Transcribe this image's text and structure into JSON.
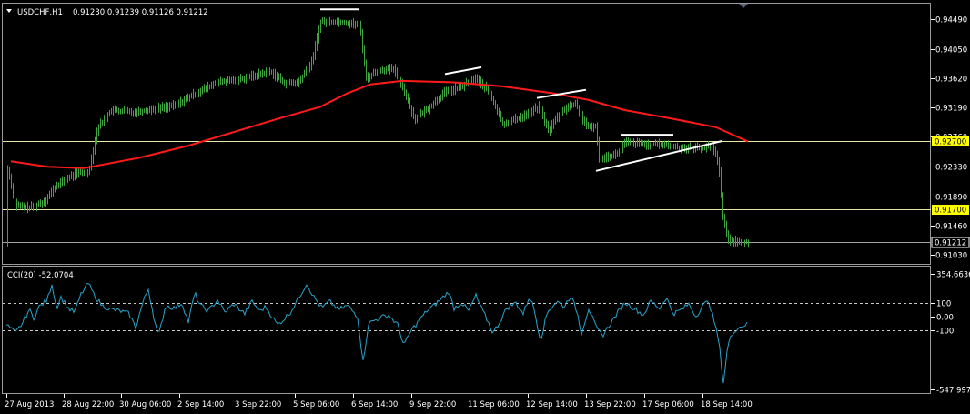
{
  "window": {
    "symbol": "USDCHF,H1",
    "ohlc": "0.91230 0.91239 0.91126 0.91212",
    "indicator_label": "CCI(20) -52.0704"
  },
  "colors": {
    "background": "#000000",
    "candles": "#3fa53f",
    "moving_average": "#ff1a1a",
    "trendlines": "#ffffff",
    "cci_line": "#29a3c8",
    "levels": "#e6e6a8",
    "price_tag": "#ffff00",
    "frame": "#9a9a9a"
  },
  "chart_data": [
    {
      "type": "candlestick",
      "symbol": "USDCHF",
      "timeframe": "H1",
      "ylim": [
        0.9091,
        0.947
      ],
      "y_ticks": [
        "0.94490",
        "0.94050",
        "0.93620",
        "0.93190",
        "0.92760",
        "0.92330",
        "0.91890",
        "0.91460",
        "0.91030"
      ],
      "horizontal_levels": [
        {
          "value": 0.927,
          "label": "0.92700"
        },
        {
          "value": 0.917,
          "label": "0.91700"
        },
        {
          "value": 0.91212,
          "label": "0.91212"
        }
      ],
      "x_ticks": [
        "27 Aug 2013",
        "28 Aug 22:00",
        "30 Aug 06:00",
        "2 Sep 14:00",
        "3 Sep 22:00",
        "5 Sep 06:00",
        "6 Sep 14:00",
        "9 Sep 22:00",
        "11 Sep 06:00",
        "12 Sep 14:00",
        "13 Sep 22:00",
        "17 Sep 06:00",
        "18 Sep 14:00"
      ],
      "close_path": [
        {
          "t": 0,
          "v": 0.9235
        },
        {
          "t": 10,
          "v": 0.9175
        },
        {
          "t": 25,
          "v": 0.9172
        },
        {
          "t": 40,
          "v": 0.918
        },
        {
          "t": 55,
          "v": 0.9205
        },
        {
          "t": 75,
          "v": 0.9222
        },
        {
          "t": 90,
          "v": 0.9225
        },
        {
          "t": 100,
          "v": 0.929
        },
        {
          "t": 115,
          "v": 0.9315
        },
        {
          "t": 140,
          "v": 0.9312
        },
        {
          "t": 165,
          "v": 0.9318
        },
        {
          "t": 185,
          "v": 0.9322
        },
        {
          "t": 205,
          "v": 0.9338
        },
        {
          "t": 230,
          "v": 0.9355
        },
        {
          "t": 260,
          "v": 0.9362
        },
        {
          "t": 290,
          "v": 0.9372
        },
        {
          "t": 305,
          "v": 0.9355
        },
        {
          "t": 320,
          "v": 0.9355
        },
        {
          "t": 335,
          "v": 0.9385
        },
        {
          "t": 345,
          "v": 0.9445
        },
        {
          "t": 365,
          "v": 0.9445
        },
        {
          "t": 388,
          "v": 0.944
        },
        {
          "t": 395,
          "v": 0.9362
        },
        {
          "t": 410,
          "v": 0.9375
        },
        {
          "t": 425,
          "v": 0.9375
        },
        {
          "t": 435,
          "v": 0.935
        },
        {
          "t": 448,
          "v": 0.9302
        },
        {
          "t": 465,
          "v": 0.932
        },
        {
          "t": 480,
          "v": 0.934
        },
        {
          "t": 500,
          "v": 0.935
        },
        {
          "t": 515,
          "v": 0.9362
        },
        {
          "t": 530,
          "v": 0.9342
        },
        {
          "t": 545,
          "v": 0.9295
        },
        {
          "t": 565,
          "v": 0.9305
        },
        {
          "t": 585,
          "v": 0.932
        },
        {
          "t": 595,
          "v": 0.9285
        },
        {
          "t": 610,
          "v": 0.9315
        },
        {
          "t": 625,
          "v": 0.9325
        },
        {
          "t": 637,
          "v": 0.929
        },
        {
          "t": 648,
          "v": 0.9292
        },
        {
          "t": 650,
          "v": 0.9245
        },
        {
          "t": 670,
          "v": 0.925
        },
        {
          "t": 680,
          "v": 0.9268
        },
        {
          "t": 700,
          "v": 0.9265
        },
        {
          "t": 720,
          "v": 0.9265
        },
        {
          "t": 740,
          "v": 0.926
        },
        {
          "t": 760,
          "v": 0.926
        },
        {
          "t": 775,
          "v": 0.9262
        },
        {
          "t": 782,
          "v": 0.924
        },
        {
          "t": 787,
          "v": 0.916
        },
        {
          "t": 792,
          "v": 0.9125
        },
        {
          "t": 805,
          "v": 0.9122
        },
        {
          "t": 815,
          "v": 0.9121
        }
      ],
      "moving_average": [
        {
          "t": 5,
          "v": 0.924
        },
        {
          "t": 45,
          "v": 0.9232
        },
        {
          "t": 85,
          "v": 0.923
        },
        {
          "t": 145,
          "v": 0.9245
        },
        {
          "t": 200,
          "v": 0.9263
        },
        {
          "t": 255,
          "v": 0.9285
        },
        {
          "t": 300,
          "v": 0.9303
        },
        {
          "t": 345,
          "v": 0.932
        },
        {
          "t": 375,
          "v": 0.934
        },
        {
          "t": 400,
          "v": 0.9353
        },
        {
          "t": 435,
          "v": 0.9358
        },
        {
          "t": 490,
          "v": 0.9356
        },
        {
          "t": 545,
          "v": 0.935
        },
        {
          "t": 600,
          "v": 0.934
        },
        {
          "t": 640,
          "v": 0.933
        },
        {
          "t": 680,
          "v": 0.9315
        },
        {
          "t": 730,
          "v": 0.9303
        },
        {
          "t": 780,
          "v": 0.929
        },
        {
          "t": 800,
          "v": 0.9278
        },
        {
          "t": 815,
          "v": 0.9269
        }
      ],
      "trendlines": [
        {
          "t1": 345,
          "v1": 0.9463,
          "t2": 388,
          "v2": 0.9463
        },
        {
          "t1": 482,
          "v1": 0.9368,
          "t2": 522,
          "v2": 0.9378
        },
        {
          "t1": 583,
          "v1": 0.9333,
          "t2": 637,
          "v2": 0.9345
        },
        {
          "t1": 675,
          "v1": 0.9279,
          "t2": 733,
          "v2": 0.9279
        },
        {
          "t1": 648,
          "v1": 0.9226,
          "t2": 787,
          "v2": 0.927
        }
      ]
    },
    {
      "type": "line",
      "title": "CCI(20) -52.0704",
      "ylim": [
        -547.9974,
        354.6636
      ],
      "y_ticks": [
        "354.6636",
        "100",
        "0.00",
        "-100",
        "-547.9974"
      ],
      "reference_levels": [
        100,
        -100
      ],
      "series": [
        {
          "name": "CCI(20)",
          "points": [
            {
              "t": 0,
              "v": -60
            },
            {
              "t": 10,
              "v": -120
            },
            {
              "t": 18,
              "v": -45
            },
            {
              "t": 25,
              "v": 50
            },
            {
              "t": 30,
              "v": -10
            },
            {
              "t": 36,
              "v": 70
            },
            {
              "t": 45,
              "v": 120
            },
            {
              "t": 50,
              "v": 240
            },
            {
              "t": 55,
              "v": 60
            },
            {
              "t": 60,
              "v": 140
            },
            {
              "t": 68,
              "v": 60
            },
            {
              "t": 75,
              "v": 30
            },
            {
              "t": 82,
              "v": 160
            },
            {
              "t": 90,
              "v": 240
            },
            {
              "t": 97,
              "v": 150
            },
            {
              "t": 105,
              "v": 80
            },
            {
              "t": 115,
              "v": 50
            },
            {
              "t": 125,
              "v": 40
            },
            {
              "t": 135,
              "v": 20
            },
            {
              "t": 142,
              "v": -80
            },
            {
              "t": 150,
              "v": 100
            },
            {
              "t": 156,
              "v": 200
            },
            {
              "t": 162,
              "v": 0
            },
            {
              "t": 167,
              "v": -150
            },
            {
              "t": 175,
              "v": 80
            },
            {
              "t": 185,
              "v": 60
            },
            {
              "t": 193,
              "v": 100
            },
            {
              "t": 200,
              "v": -40
            },
            {
              "t": 207,
              "v": 170
            },
            {
              "t": 213,
              "v": 80
            },
            {
              "t": 222,
              "v": 40
            },
            {
              "t": 232,
              "v": 120
            },
            {
              "t": 240,
              "v": 30
            },
            {
              "t": 250,
              "v": 90
            },
            {
              "t": 262,
              "v": 20
            },
            {
              "t": 270,
              "v": 110
            },
            {
              "t": 278,
              "v": 40
            },
            {
              "t": 285,
              "v": 70
            },
            {
              "t": 292,
              "v": 0
            },
            {
              "t": 298,
              "v": -60
            },
            {
              "t": 305,
              "v": -20
            },
            {
              "t": 312,
              "v": 30
            },
            {
              "t": 320,
              "v": 120
            },
            {
              "t": 330,
              "v": 240
            },
            {
              "t": 338,
              "v": 140
            },
            {
              "t": 347,
              "v": 60
            },
            {
              "t": 355,
              "v": 110
            },
            {
              "t": 365,
              "v": 50
            },
            {
              "t": 375,
              "v": 80
            },
            {
              "t": 386,
              "v": 0
            },
            {
              "t": 392,
              "v": -330
            },
            {
              "t": 398,
              "v": -50
            },
            {
              "t": 410,
              "v": -10
            },
            {
              "t": 420,
              "v": 10
            },
            {
              "t": 430,
              "v": -60
            },
            {
              "t": 437,
              "v": -210
            },
            {
              "t": 445,
              "v": -100
            },
            {
              "t": 455,
              "v": -20
            },
            {
              "t": 462,
              "v": 40
            },
            {
              "t": 470,
              "v": 80
            },
            {
              "t": 480,
              "v": 140
            },
            {
              "t": 486,
              "v": 180
            },
            {
              "t": 492,
              "v": 60
            },
            {
              "t": 500,
              "v": 100
            },
            {
              "t": 508,
              "v": 40
            },
            {
              "t": 516,
              "v": 150
            },
            {
              "t": 522,
              "v": 60
            },
            {
              "t": 528,
              "v": -20
            },
            {
              "t": 535,
              "v": -120
            },
            {
              "t": 542,
              "v": -40
            },
            {
              "t": 550,
              "v": 60
            },
            {
              "t": 560,
              "v": 100
            },
            {
              "t": 568,
              "v": 20
            },
            {
              "t": 575,
              "v": 150
            },
            {
              "t": 580,
              "v": 50
            },
            {
              "t": 587,
              "v": -170
            },
            {
              "t": 595,
              "v": 40
            },
            {
              "t": 605,
              "v": 110
            },
            {
              "t": 613,
              "v": 70
            },
            {
              "t": 620,
              "v": 150
            },
            {
              "t": 627,
              "v": 40
            },
            {
              "t": 632,
              "v": -120
            },
            {
              "t": 640,
              "v": 60
            },
            {
              "t": 648,
              "v": -80
            },
            {
              "t": 655,
              "v": -140
            },
            {
              "t": 665,
              "v": -40
            },
            {
              "t": 672,
              "v": 30
            },
            {
              "t": 680,
              "v": 100
            },
            {
              "t": 690,
              "v": 60
            },
            {
              "t": 700,
              "v": 10
            },
            {
              "t": 708,
              "v": 110
            },
            {
              "t": 718,
              "v": 60
            },
            {
              "t": 725,
              "v": 140
            },
            {
              "t": 733,
              "v": 20
            },
            {
              "t": 742,
              "v": 50
            },
            {
              "t": 750,
              "v": 90
            },
            {
              "t": 758,
              "v": 0
            },
            {
              "t": 765,
              "v": 80
            },
            {
              "t": 772,
              "v": 110
            },
            {
              "t": 778,
              "v": -40
            },
            {
              "t": 783,
              "v": -180
            },
            {
              "t": 788,
              "v": -480
            },
            {
              "t": 793,
              "v": -200
            },
            {
              "t": 800,
              "v": -100
            },
            {
              "t": 808,
              "v": -70
            },
            {
              "t": 815,
              "v": -52
            }
          ]
        }
      ]
    }
  ]
}
